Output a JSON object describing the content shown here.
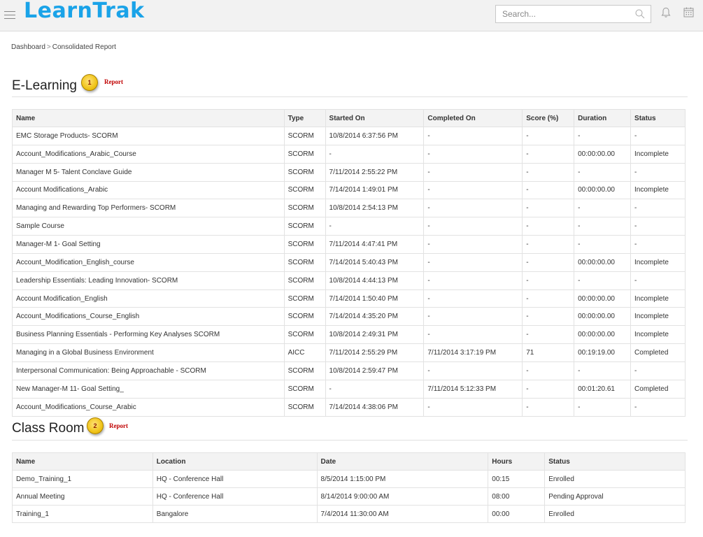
{
  "header": {
    "logo": "LearnTrak",
    "search_placeholder": "Search..."
  },
  "breadcrumb": {
    "home": "Dashboard",
    "separator": ">",
    "current": "Consolidated Report"
  },
  "elearning": {
    "title": "E-Learning",
    "badge_number": "1",
    "badge_label": "Report",
    "columns": [
      "Name",
      "Type",
      "Started On",
      "Completed On",
      "Score (%)",
      "Duration",
      "Status"
    ],
    "rows": [
      [
        "EMC Storage Products- SCORM",
        "SCORM",
        "10/8/2014 6:37:56 PM",
        "-",
        "-",
        "-",
        "-"
      ],
      [
        "Account_Modifications_Arabic_Course",
        "SCORM",
        "-",
        "-",
        "-",
        "00:00:00.00",
        "Incomplete"
      ],
      [
        "Manager M 5- Talent Conclave Guide",
        "SCORM",
        "7/11/2014 2:55:22 PM",
        "-",
        "-",
        "-",
        "-"
      ],
      [
        "Account Modifications_Arabic",
        "SCORM",
        "7/14/2014 1:49:01 PM",
        "-",
        "-",
        "00:00:00.00",
        "Incomplete"
      ],
      [
        "Managing and Rewarding Top Performers- SCORM",
        "SCORM",
        "10/8/2014 2:54:13 PM",
        "-",
        "-",
        "-",
        "-"
      ],
      [
        "Sample Course",
        "SCORM",
        "-",
        "-",
        "-",
        "-",
        "-"
      ],
      [
        "Manager-M 1- Goal Setting",
        "SCORM",
        "7/11/2014 4:47:41 PM",
        "-",
        "-",
        "-",
        "-"
      ],
      [
        "Account_Modification_English_course",
        "SCORM",
        "7/14/2014 5:40:43 PM",
        "-",
        "-",
        "00:00:00.00",
        "Incomplete"
      ],
      [
        "Leadership Essentials: Leading Innovation- SCORM",
        "SCORM",
        "10/8/2014 4:44:13 PM",
        "-",
        "-",
        "-",
        "-"
      ],
      [
        "Account Modification_English",
        "SCORM",
        "7/14/2014 1:50:40 PM",
        "-",
        "-",
        "00:00:00.00",
        "Incomplete"
      ],
      [
        "Account_Modifications_Course_English",
        "SCORM",
        "7/14/2014 4:35:20 PM",
        "-",
        "-",
        "00:00:00.00",
        "Incomplete"
      ],
      [
        "Business Planning Essentials - Performing Key Analyses SCORM",
        "SCORM",
        "10/8/2014 2:49:31 PM",
        "-",
        "-",
        "00:00:00.00",
        "Incomplete"
      ],
      [
        "Managing in a Global Business Environment",
        "AICC",
        "7/11/2014 2:55:29 PM",
        "7/11/2014 3:17:19 PM",
        "71",
        "00:19:19.00",
        "Completed"
      ],
      [
        "Interpersonal Communication: Being Approachable - SCORM",
        "SCORM",
        "10/8/2014 2:59:47 PM",
        "-",
        "-",
        "-",
        "-"
      ],
      [
        "New Manager-M 11- Goal Setting_",
        "SCORM",
        "-",
        "7/11/2014 5:12:33 PM",
        "-",
        "00:01:20.61",
        "Completed"
      ],
      [
        "Account_Modifications_Course_Arabic",
        "SCORM",
        "7/14/2014 4:38:06 PM",
        "-",
        "-",
        "-",
        "-"
      ]
    ]
  },
  "classroom": {
    "title": "Class Room",
    "badge_number": "2",
    "badge_label": "Report",
    "columns": [
      "Name",
      "Location",
      "Date",
      "Hours",
      "Status"
    ],
    "rows": [
      [
        "Demo_Training_1",
        "HQ - Conference Hall",
        "8/5/2014 1:15:00 PM",
        "00:15",
        "Enrolled"
      ],
      [
        "Annual Meeting",
        "HQ - Conference Hall",
        "8/14/2014 9:00:00 AM",
        "08:00",
        "Pending Approval"
      ],
      [
        "Training_1",
        "Bangalore",
        "7/4/2014 11:30:00 AM",
        "00:00",
        "Enrolled"
      ]
    ]
  }
}
